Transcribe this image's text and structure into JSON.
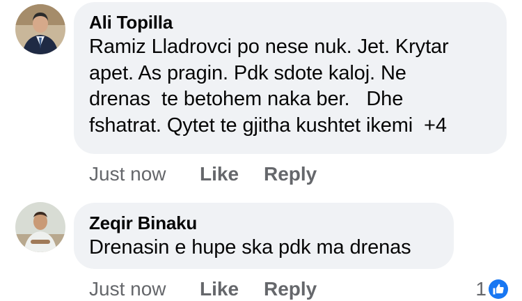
{
  "comments": [
    {
      "author": "Ali Topilla",
      "avatar_icon": "profile-photo-man-suit",
      "text_lines": [
        "Ramiz Lladrovci po nese nuk. Jet. Krytar",
        "apet. As pragin. Pdk sdote kaloj. Ne",
        "drenas  te betohem naka ber.   Dhe",
        "fshatrat. Qytet te gjitha kushtet ikemi  +4"
      ],
      "time": "Just now",
      "like_label": "Like",
      "reply_label": "Reply"
    },
    {
      "author": "Zeqir Binaku",
      "avatar_icon": "profile-photo-man-sitting",
      "text_lines": [
        "Drenasin e hupe ska pdk ma drenas"
      ],
      "time": "Just now",
      "like_label": "Like",
      "reply_label": "Reply",
      "reaction_count": "1",
      "reaction_icon": "thumbs-up-icon",
      "reaction_color": "#1877f2"
    }
  ]
}
